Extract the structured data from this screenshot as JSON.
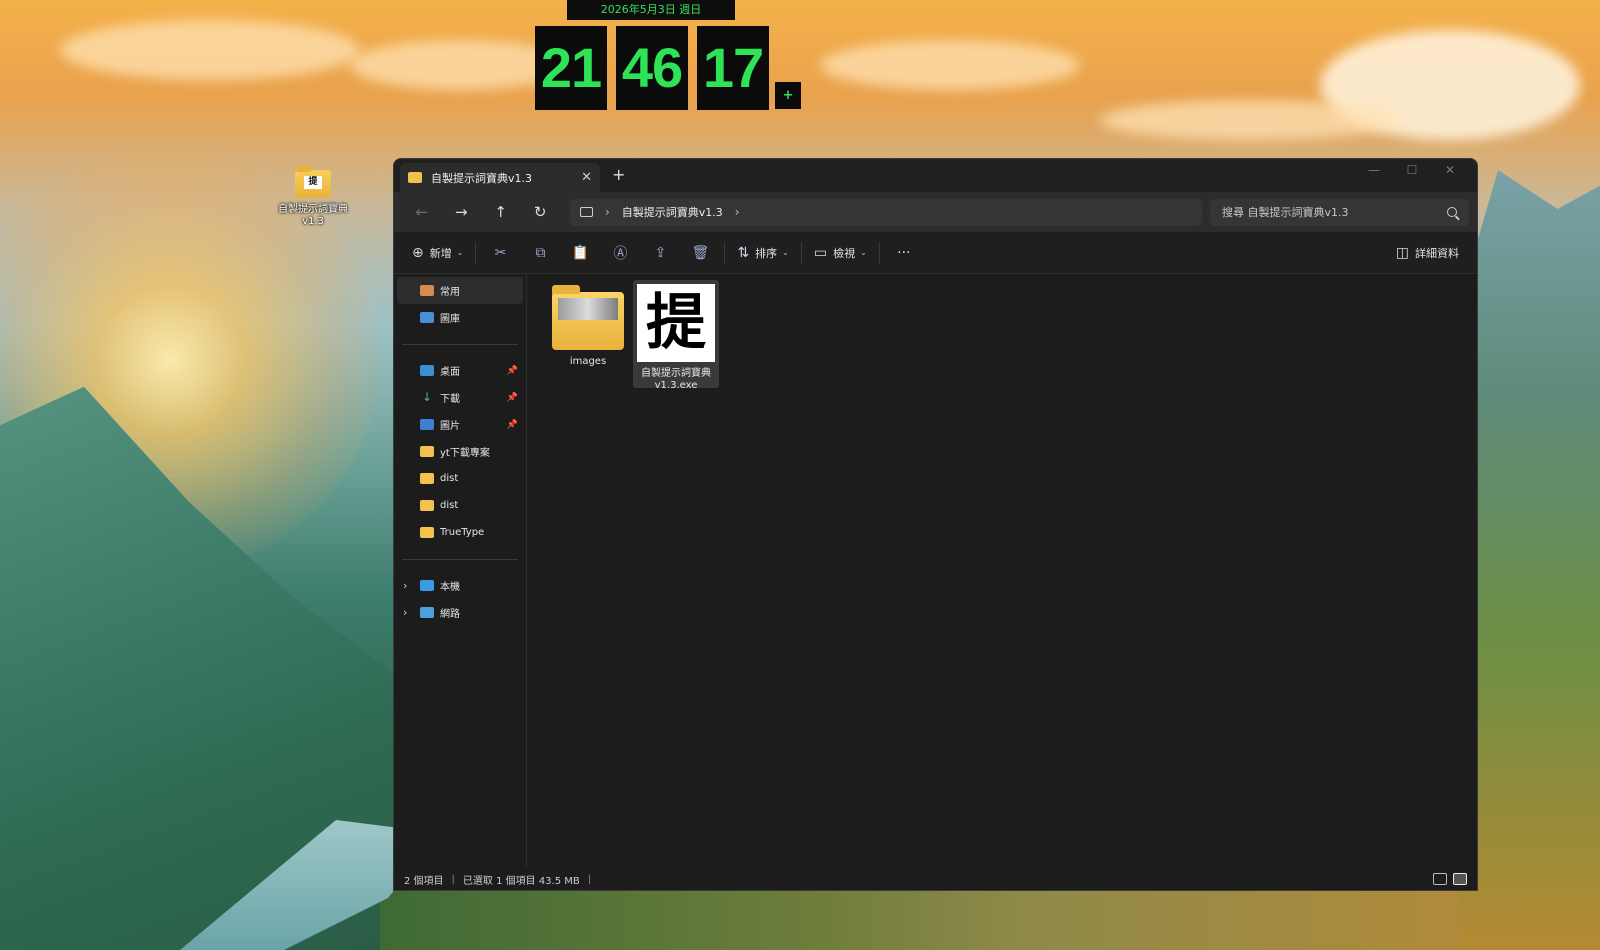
{
  "clock": {
    "date": "2026年5月3日 週日",
    "hours": "21",
    "minutes": "46",
    "seconds": "17",
    "plus": "+"
  },
  "desktop": {
    "icon_label": "自製提示詞寶典v1.3",
    "icon_thumb_text": "提"
  },
  "window": {
    "tab_title": "自製提示詞寶典v1.3",
    "tab_close": "✕",
    "new_tab": "+",
    "controls": {
      "minimize": "—",
      "maximize": "☐",
      "close": "✕"
    }
  },
  "nav": {
    "back": "←",
    "forward": "→",
    "up": "↑",
    "refresh": "↻",
    "sep": "›",
    "breadcrumb": "自製提示詞寶典v1.3",
    "trail_sep": "›",
    "search_placeholder": "搜尋 自製提示詞寶典v1.3"
  },
  "commandbar": {
    "new_label": "新增",
    "new_glyph": "⊕",
    "cut": "✂",
    "copy": "⧉",
    "paste": "📋",
    "rename": "Ⓐ",
    "share": "⇪",
    "delete": "🗑",
    "sort_label": "排序",
    "sort_glyph": "⇅",
    "view_label": "檢視",
    "view_glyph": "▭",
    "more": "···",
    "details_label": "詳細資料",
    "details_glyph": "◫",
    "caret": "⌄"
  },
  "sidebar": {
    "quick": [
      {
        "label": "常用",
        "icon": "home-icon"
      },
      {
        "label": "圖庫",
        "icon": "gallery-icon"
      }
    ],
    "pinned": [
      {
        "label": "桌面",
        "icon": "desktop-icon",
        "pinned": true
      },
      {
        "label": "下載",
        "icon": "download-icon",
        "pinned": true
      },
      {
        "label": "圖片",
        "icon": "pictures-icon",
        "pinned": true
      },
      {
        "label": "yt下載專案",
        "icon": "folder-icon"
      },
      {
        "label": "dist",
        "icon": "folder-icon"
      },
      {
        "label": "dist",
        "icon": "folder-icon"
      },
      {
        "label": "TrueType",
        "icon": "folder-icon"
      }
    ],
    "roots": [
      {
        "label": "本機",
        "icon": "pc-icon"
      },
      {
        "label": "網路",
        "icon": "network-icon"
      }
    ],
    "pin_glyph": "📌",
    "chevron": "›",
    "download_glyph": "↓"
  },
  "files": [
    {
      "name": "images",
      "type": "folder"
    },
    {
      "name": "自製提示詞寶典 v1.3.exe",
      "type": "exe",
      "thumb": "提",
      "selected": true
    }
  ],
  "status": {
    "count": "2 個項目",
    "selection": "已選取 1 個項目 43.5 MB",
    "divider": "|"
  }
}
